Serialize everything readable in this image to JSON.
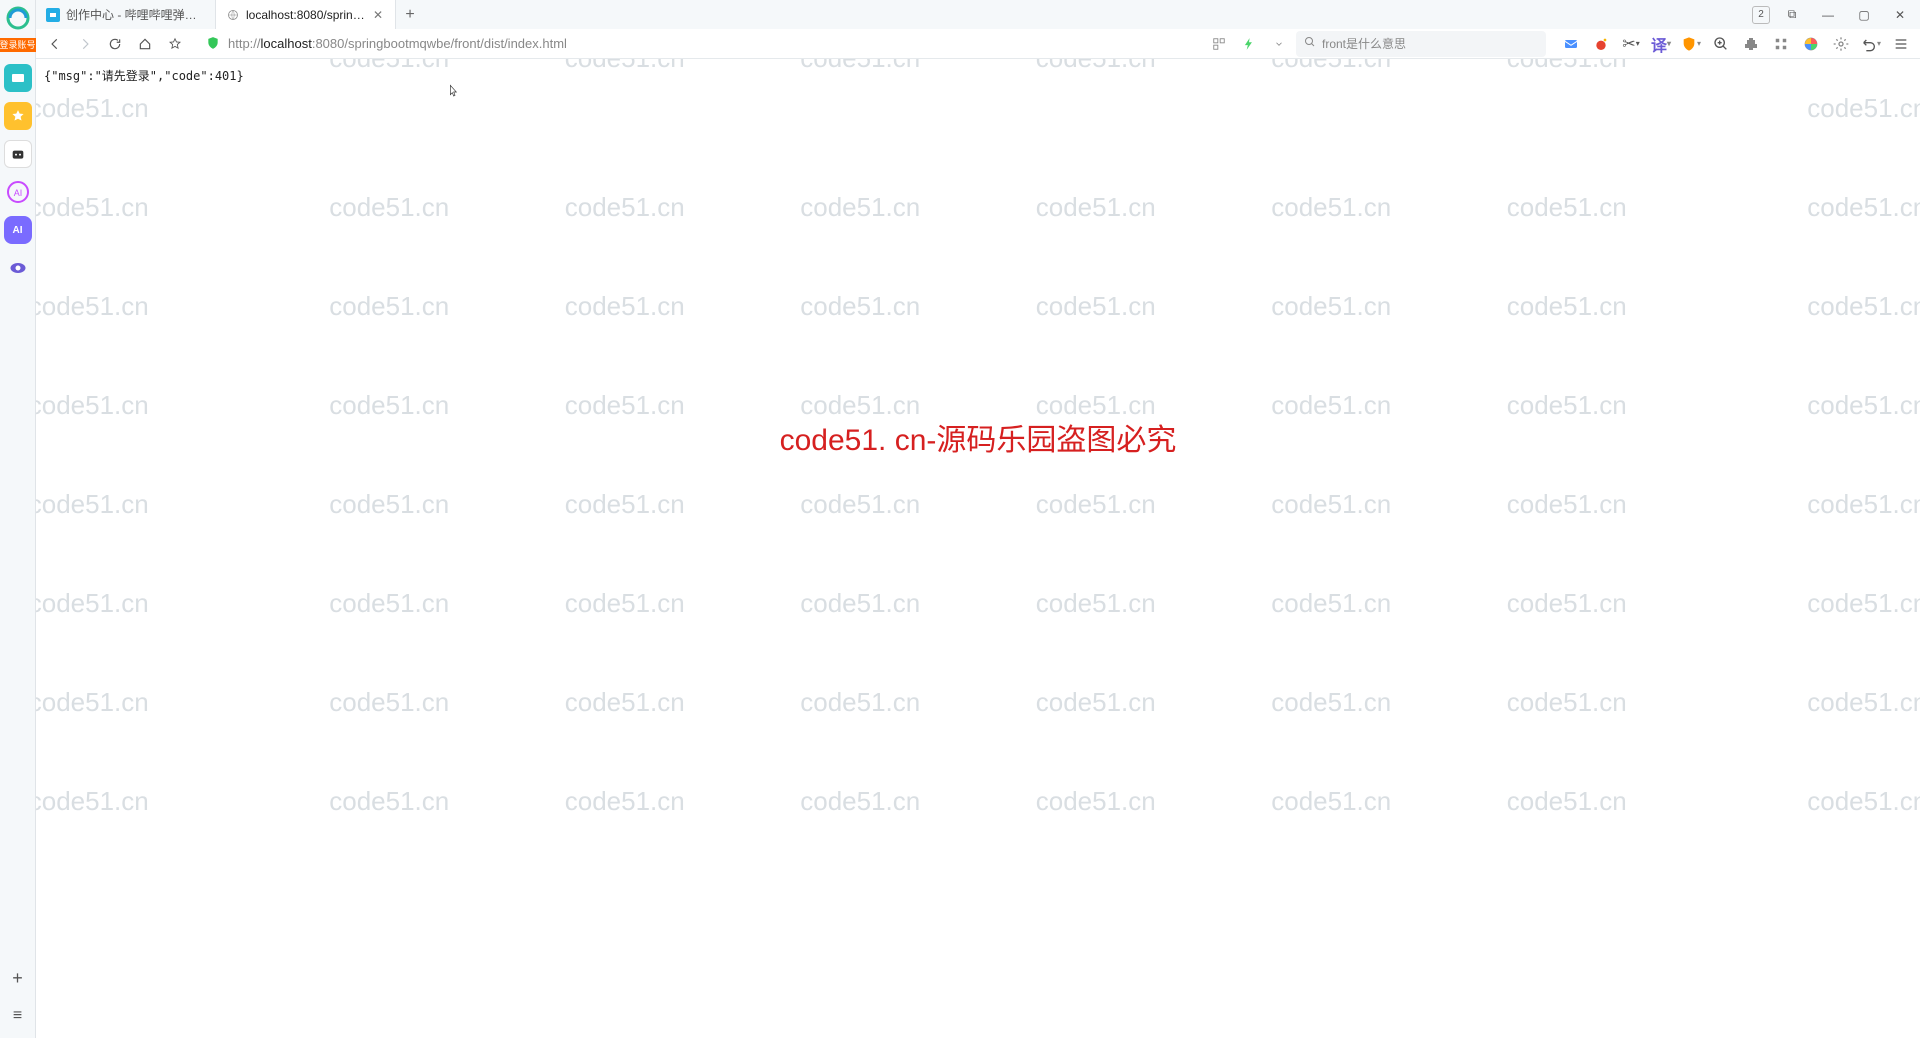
{
  "browser": {
    "tabs": [
      {
        "title": "创作中心 - 哔哩哔哩弹幕视频网",
        "active": false
      },
      {
        "title": "localhost:8080/springbootmq",
        "active": true
      }
    ],
    "new_tab_label": "+",
    "window_controls": {
      "indicator": "2",
      "pin": "⧉",
      "minimize": "—",
      "maximize": "▢",
      "close": "✕"
    }
  },
  "toolbar": {
    "url_prefix": "http://",
    "url_host": "localhost",
    "url_path": ":8080/springbootmqwbe/front/dist/index.html",
    "search_placeholder": "front是什么意思"
  },
  "sidebar": {
    "login_label": "登录账号",
    "add_label": "+",
    "menu_label": "≡"
  },
  "page": {
    "response_text": "{\"msg\":\"请先登录\",\"code\":401}"
  },
  "watermark": {
    "text": "code51.cn",
    "center_text": "code51. cn-源码乐园盗图必究"
  }
}
